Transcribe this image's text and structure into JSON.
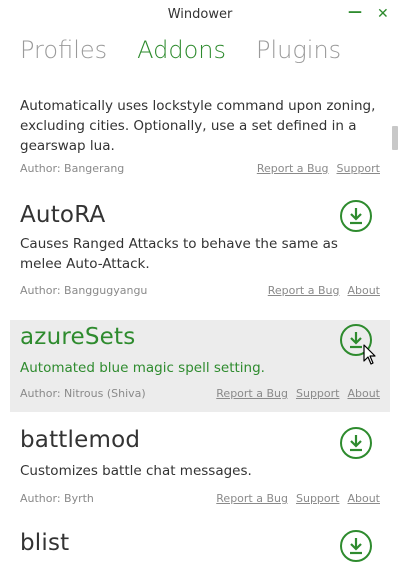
{
  "window": {
    "title": "Windower",
    "minimize_glyph": "—",
    "close_glyph": "✕"
  },
  "tabs": [
    {
      "label": "Profiles",
      "active": false
    },
    {
      "label": "Addons",
      "active": true
    },
    {
      "label": "Plugins",
      "active": false
    }
  ],
  "addons": [
    {
      "name": "",
      "description": "Automatically uses lockstyle command upon zoning, excluding cities. Optionally, use a set defined in a gearswap lua.",
      "author": "Author: Bangerang",
      "links": [
        "Report a Bug",
        "Support"
      ]
    },
    {
      "name": "AutoRA",
      "description": "Causes Ranged Attacks to behave the same as melee Auto-Attack.",
      "author": "Author: Banggugyangu",
      "links": [
        "Report a Bug",
        "About"
      ]
    },
    {
      "name": "azureSets",
      "description": "Automated blue magic spell setting.",
      "author": "Author: Nitrous (Shiva)",
      "links": [
        "Report a Bug",
        "Support",
        "About"
      ]
    },
    {
      "name": "battlemod",
      "description": "Customizes battle chat messages.",
      "author": "Author: Byrth",
      "links": [
        "Report a Bug",
        "Support",
        "About"
      ]
    },
    {
      "name": "blist",
      "description": "",
      "author": "",
      "links": []
    }
  ],
  "colors": {
    "accent": "#2e8b2e",
    "hover_bg": "#ececec",
    "muted": "#8a8a8a"
  },
  "icons": {
    "download": "download-circle-icon"
  }
}
